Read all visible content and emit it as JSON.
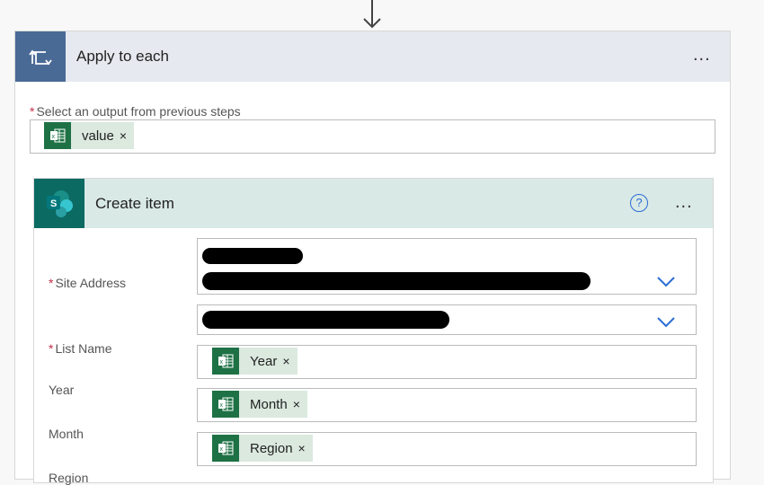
{
  "apply_each": {
    "title": "Apply to each",
    "more": "...",
    "select_label": "Select an output from previous steps",
    "required_mark": "*",
    "token": "value"
  },
  "create_item": {
    "title": "Create item",
    "help": "?",
    "more": "...",
    "fields": [
      {
        "label": "Site Address",
        "required": "*"
      },
      {
        "label": "List Name",
        "required": "*"
      },
      {
        "label": "Year",
        "token": "Year"
      },
      {
        "label": "Month",
        "token": "Month"
      },
      {
        "label": "Region",
        "token": "Region"
      }
    ]
  },
  "token_remove": "×",
  "colors": {
    "loop_header": "#4a6a96",
    "sharepoint": "#0b6a62",
    "excel": "#1e7145",
    "help": "#2b6cd4"
  }
}
